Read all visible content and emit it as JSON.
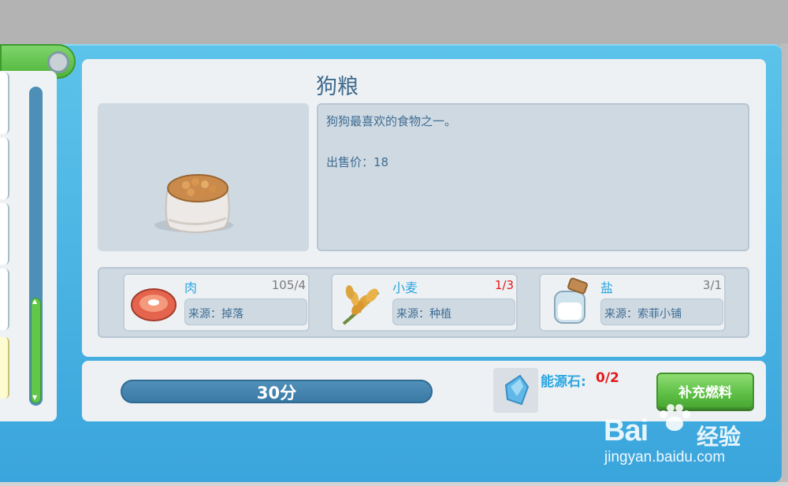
{
  "item": {
    "title": "狗粮",
    "description": "狗狗最喜欢的食物之一。",
    "price_text": "出售价：18"
  },
  "ingredients": [
    {
      "name": "肉",
      "count": "105/4",
      "source": "来源：掉落",
      "icon": "meat-icon",
      "lacking": false
    },
    {
      "name": "小麦",
      "count": "1/3",
      "source": "来源：种植",
      "icon": "wheat-icon",
      "lacking": true
    },
    {
      "name": "盐",
      "count": "3/1",
      "source": "来源：索菲小铺",
      "icon": "salt-jar-icon",
      "lacking": false
    }
  ],
  "bottom": {
    "time_label": "30分",
    "energy_label": "能源石:",
    "energy_count": "0/2",
    "refuel_button": "补充燃料"
  },
  "watermark": {
    "logo": "Bai",
    "logo2": "经验",
    "url": "jingyan.baidu.com"
  },
  "colors": {
    "panel_blue": "#3aa5dc",
    "accent_green": "#5dbf45",
    "warning_red": "#e11a1a",
    "label_blue": "#2aa5e0"
  }
}
